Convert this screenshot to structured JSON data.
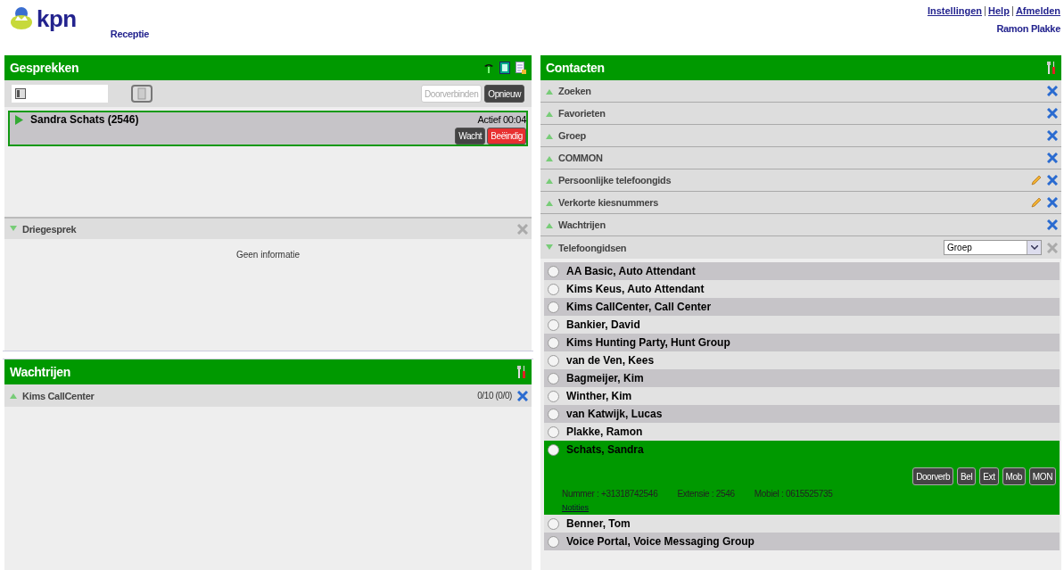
{
  "header": {
    "logo_text": "kpn",
    "app_title": "Receptie",
    "links": [
      "Instellingen",
      "Help",
      "Afmelden"
    ],
    "user": "Ramon Plakke"
  },
  "calls_panel": {
    "title": "Gesprekken",
    "buttons": [
      {
        "label": "Doorverbinden",
        "disabled": true
      },
      {
        "label": "Opnieuw",
        "disabled": false
      }
    ],
    "calls": [
      {
        "name": "Sandra Schats (2546)",
        "status": "Actief 00:04",
        "actions": [
          {
            "label": "Wacht",
            "kind": "dark"
          },
          {
            "label": "Beëindig",
            "kind": "danger"
          }
        ]
      }
    ],
    "conference": {
      "title": "Driegesprek",
      "expanded": true,
      "closable": false,
      "message": "Geen informatie"
    }
  },
  "queues_panel": {
    "title": "Wachtrijen",
    "queues": [
      {
        "name": "Kims CallCenter",
        "expanded": false,
        "count": "0/10 (0/0)"
      }
    ]
  },
  "contacts_panel": {
    "title": "Contacten",
    "sections": [
      {
        "label": "Zoeken",
        "expanded": false,
        "editable": false,
        "closable": true
      },
      {
        "label": "Favorieten",
        "expanded": false,
        "editable": false,
        "closable": true
      },
      {
        "label": "Groep",
        "expanded": false,
        "editable": false,
        "closable": true
      },
      {
        "label": "COMMON",
        "expanded": false,
        "editable": false,
        "closable": true
      },
      {
        "label": "Persoonlijke telefoongids",
        "expanded": false,
        "editable": true,
        "closable": true
      },
      {
        "label": "Verkorte kiesnummers",
        "expanded": false,
        "editable": true,
        "closable": true
      },
      {
        "label": "Wachtrijen",
        "expanded": false,
        "editable": false,
        "closable": true
      },
      {
        "label": "Telefoongidsen",
        "expanded": true,
        "editable": false,
        "closable": false,
        "select": "Groep"
      }
    ],
    "contacts": [
      {
        "name": "AA Basic, Auto Attendant",
        "selected": false
      },
      {
        "name": "Kims Keus, Auto Attendant",
        "selected": false
      },
      {
        "name": "Kims CallCenter, Call Center",
        "selected": false
      },
      {
        "name": "Bankier, David",
        "selected": false
      },
      {
        "name": "Kims Hunting Party, Hunt Group",
        "selected": false
      },
      {
        "name": "van de Ven, Kees",
        "selected": false
      },
      {
        "name": "Bagmeijer, Kim",
        "selected": false
      },
      {
        "name": "Winther, Kim",
        "selected": false
      },
      {
        "name": "van Katwijk, Lucas",
        "selected": false
      },
      {
        "name": "Plakke, Ramon",
        "selected": false
      },
      {
        "name": "Schats, Sandra",
        "selected": true,
        "actions": [
          "Doorverb",
          "Bel",
          "Ext",
          "Mob",
          "MON"
        ],
        "details": [
          "Nummer : +31318742546",
          "Extensie : 2546",
          "Mobiel : 0615525735"
        ],
        "notes_link": "Notities"
      },
      {
        "name": "Benner, Tom",
        "selected": false
      },
      {
        "name": "Voice Portal, Voice Messaging Group",
        "selected": false
      }
    ]
  }
}
